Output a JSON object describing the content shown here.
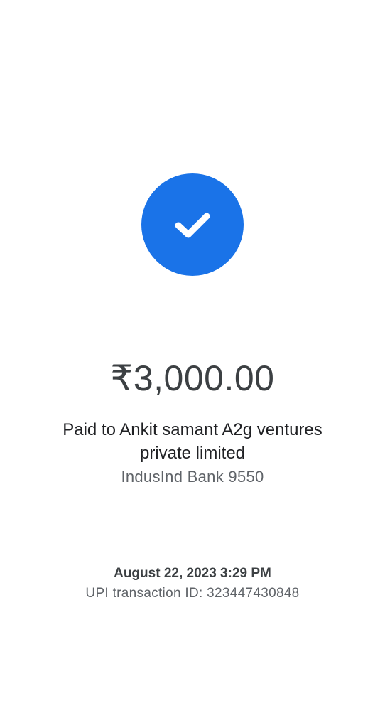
{
  "payment": {
    "status_icon": "checkmark-icon",
    "status_color": "#1a73e8",
    "amount": "₹3,000.00",
    "paid_to": "Paid to Ankit samant A2g ventures private limited",
    "bank": "IndusInd Bank 9550",
    "datetime": "August 22, 2023 3:29 PM",
    "transaction_id": "UPI transaction ID: 323447430848"
  }
}
